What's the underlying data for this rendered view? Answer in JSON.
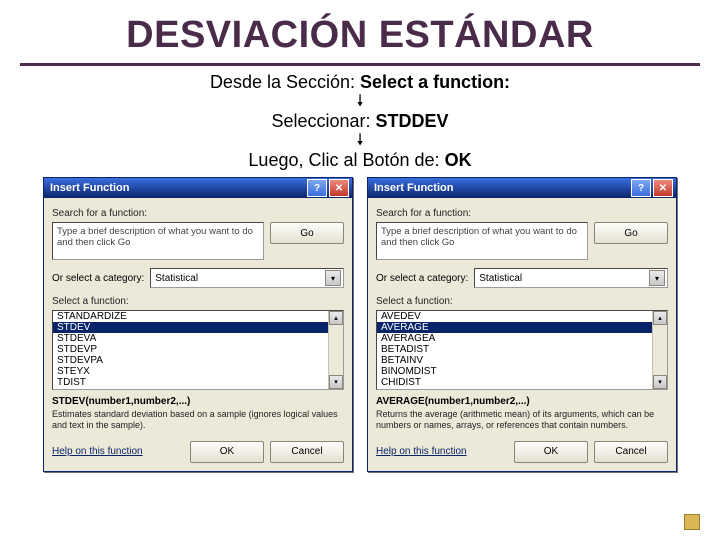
{
  "title": "DESVIACIÓN ESTÁNDAR",
  "step1_prefix": "Desde la Sección: ",
  "step1_bold": "Select a function:",
  "step2_prefix": "Seleccionar: ",
  "step2_bold": "STDDEV",
  "step3_prefix": "Luego, Clic al Botón de: ",
  "step3_bold": "OK",
  "dialog_common": {
    "title": "Insert Function",
    "search_label": "Search for a function:",
    "search_text": "Type a brief description of what you want to do and then click Go",
    "go_label": "Go",
    "category_label": "Or select a category:",
    "category_value": "Statistical",
    "list_label": "Select a function:",
    "help_label": "Help on this function",
    "ok_label": "OK",
    "cancel_label": "Cancel"
  },
  "dialog_left": {
    "items": [
      "STANDARDIZE",
      "STDEV",
      "STDEVA",
      "STDEVP",
      "STDEVPA",
      "STEYX",
      "TDIST"
    ],
    "selected": "STDEV",
    "syntax": "STDEV(number1,number2,...)",
    "desc": "Estimates standard deviation based on a sample (ignores logical values and text in the sample)."
  },
  "dialog_right": {
    "items": [
      "AVEDEV",
      "AVERAGE",
      "AVERAGEA",
      "BETADIST",
      "BETAINV",
      "BINOMDIST",
      "CHIDIST"
    ],
    "selected": "AVERAGE",
    "syntax": "AVERAGE(number1,number2,...)",
    "desc": "Returns the average (arithmetic mean) of its arguments, which can be numbers or names, arrays, or references that contain numbers."
  }
}
